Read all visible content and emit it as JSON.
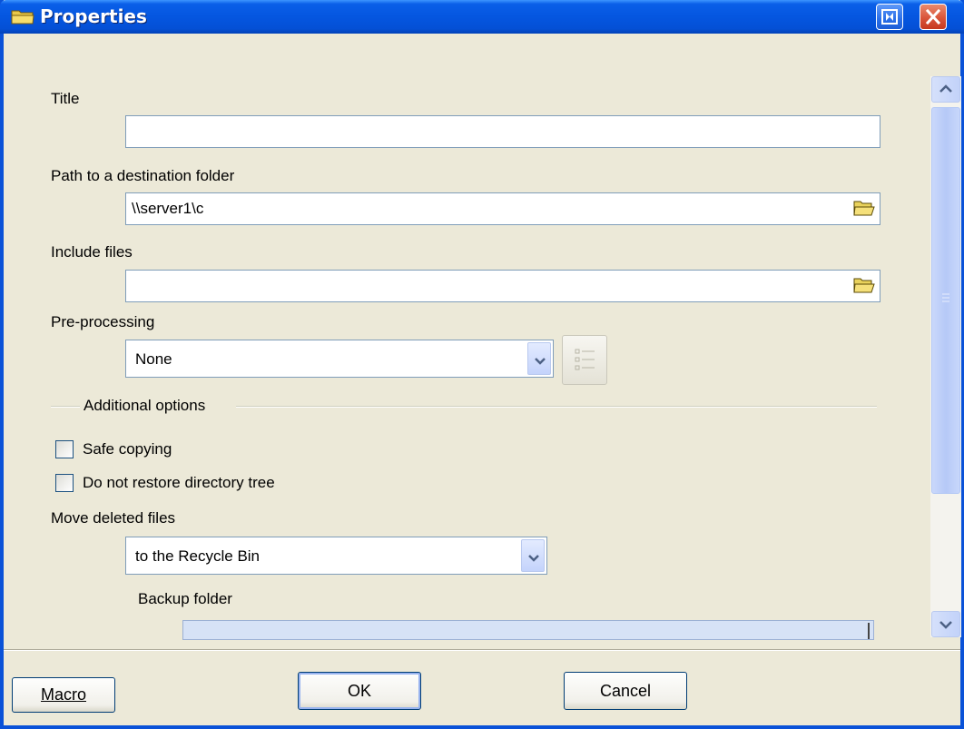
{
  "window": {
    "title": "Properties"
  },
  "form": {
    "title_label": "Title",
    "title_value": "",
    "path_label": "Path to a destination folder",
    "path_value": "\\\\server1\\c",
    "include_label": "Include files",
    "include_value": "",
    "preprocessing_label": "Pre-processing",
    "preprocessing_value": "None",
    "additional_options_label": "Additional options",
    "safe_copying_label": "Safe copying",
    "safe_copying_checked": false,
    "no_restore_tree_label": "Do not restore directory tree",
    "no_restore_tree_checked": false,
    "move_deleted_label": "Move deleted files",
    "move_deleted_value": "to the Recycle Bin",
    "backup_folder_label": "Backup folder",
    "backup_folder_value": ""
  },
  "buttons": {
    "macro": "Macro",
    "ok": "OK",
    "cancel": "Cancel"
  },
  "colors": {
    "titlebar": "#0556e0",
    "dialog_bg": "#ece9d8",
    "field_border": "#7f9db9"
  },
  "icons": [
    "folder-icon",
    "pin-icon",
    "close-icon",
    "list-icon",
    "chevron-down-icon",
    "chevron-up-icon"
  ]
}
